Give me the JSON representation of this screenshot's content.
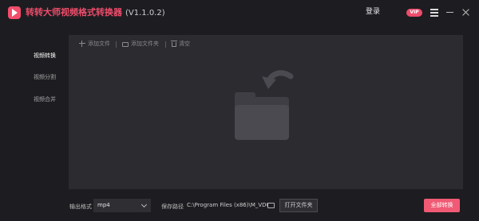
{
  "app": {
    "title": "转转大师视频格式转换器",
    "version": "(V1.1.0.2)",
    "login_label": "登录",
    "vip_label": "VIP"
  },
  "sidebar": {
    "items": [
      {
        "label": "视频转换",
        "active": true
      },
      {
        "label": "视频分割",
        "active": false
      },
      {
        "label": "视频合并",
        "active": false
      }
    ]
  },
  "toolbar": {
    "add_file": "添加文件",
    "add_folder": "添加文件夹",
    "clear": "清空"
  },
  "bottom": {
    "format_label": "输出格式",
    "format_value": "mp4",
    "save_path_label": "保存路径",
    "save_path_value": "C:\\Program Files (x86)\\M_VDC",
    "open_folder_label": "打开文件夹",
    "convert_all_label": "全部转换"
  },
  "colors": {
    "accent": "#f05a74",
    "background": "#1d1d21",
    "panel": "#2b2b30"
  }
}
